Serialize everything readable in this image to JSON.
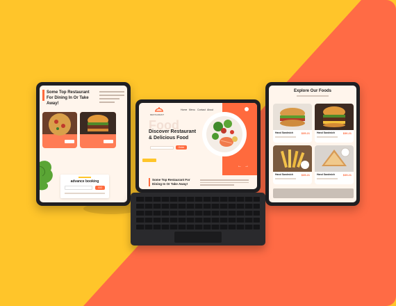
{
  "colors": {
    "yellow": "#ffc52a",
    "orange": "#ff6b45",
    "accent": "#ff6a3d",
    "screen_bg": "#fff5ec",
    "device": "#1f1f22"
  },
  "left_tablet": {
    "heading": "Some Top Restaurant For Dining In Or Take Away!",
    "booking_title": "advance booking",
    "booking_button": "GO"
  },
  "center_tablet": {
    "brand": "RESTAURANT",
    "nav": [
      "Home",
      "Menu",
      "Contact",
      "About"
    ],
    "watermark": "Food",
    "hero_title": "Discover Restaurant & Delicious Food",
    "hero_button": "Order",
    "bottom_heading": "Some Top Restaurant For Dining In Or Take Away!",
    "icon_names": [
      "dish-logo-icon",
      "arrow-left-icon",
      "arrow-right-icon"
    ]
  },
  "right_tablet": {
    "title": "Explore Our Foods",
    "items": [
      {
        "name": "Hand Sandwich",
        "price": "$35.21"
      },
      {
        "name": "Hand Sandwich",
        "price": "$36.21"
      },
      {
        "name": "Hand Sandwich",
        "price": "$35.21"
      },
      {
        "name": "Hand Sandwich",
        "price": "$35.21"
      }
    ]
  }
}
